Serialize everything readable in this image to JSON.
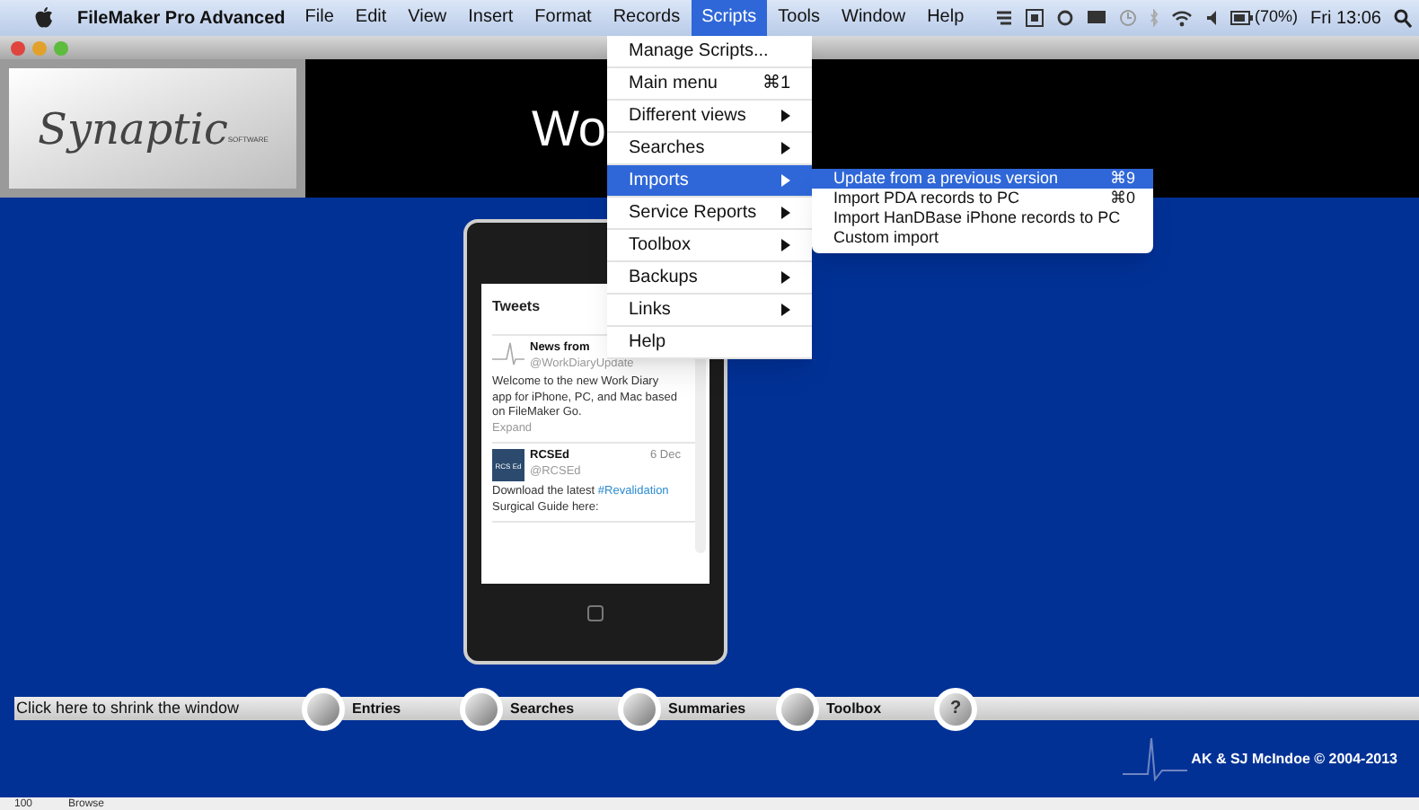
{
  "menu_bar": {
    "app_name": "FileMaker Pro Advanced",
    "items": [
      {
        "label": "File",
        "selected": false
      },
      {
        "label": "Edit",
        "selected": false
      },
      {
        "label": "View",
        "selected": false
      },
      {
        "label": "Insert",
        "selected": false
      },
      {
        "label": "Format",
        "selected": false
      },
      {
        "label": "Records",
        "selected": false
      },
      {
        "label": "Scripts",
        "selected": true
      },
      {
        "label": "Tools",
        "selected": false
      },
      {
        "label": "Window",
        "selected": false
      },
      {
        "label": "Help",
        "selected": false
      }
    ],
    "battery": "(70%)",
    "clock": "Fri 13:06"
  },
  "header": {
    "logo": "Synaptic",
    "logo_sub": "SOFTWARE",
    "title": "Wo"
  },
  "scripts_menu": [
    {
      "label": "Manage Scripts...",
      "selected": false
    },
    {
      "label": "Main menu",
      "shortcut": "⌘1",
      "selected": false
    },
    {
      "label": "Different views",
      "submenu": true,
      "selected": false
    },
    {
      "label": "Searches",
      "submenu": true,
      "selected": false
    },
    {
      "label": "Imports",
      "submenu": true,
      "selected": true
    },
    {
      "label": "Service Reports",
      "submenu": true,
      "selected": false
    },
    {
      "label": "Toolbox",
      "submenu": true,
      "selected": false
    },
    {
      "label": "Backups",
      "submenu": true,
      "selected": false
    },
    {
      "label": "Links",
      "submenu": true,
      "selected": false
    },
    {
      "label": "Help",
      "selected": false
    }
  ],
  "imports_submenu": [
    {
      "label": "Update from a previous version",
      "shortcut": "⌘9",
      "selected": true
    },
    {
      "label": "Import PDA records to PC",
      "shortcut": "⌘0",
      "selected": false
    },
    {
      "label": "Import HanDBase iPhone records to PC",
      "selected": false
    },
    {
      "label": "Custom import",
      "selected": false
    }
  ],
  "tweets": {
    "title": "Tweets",
    "items": [
      {
        "name": "News from",
        "handle": "@WorkDiaryUpdate",
        "body": [
          {
            "kind": "text",
            "text": "Welcome to the new Work Diary app for iPhone, PC, and Mac based on FileMaker Go."
          }
        ],
        "action": "Expand"
      },
      {
        "name": "RCSEd",
        "avatar": "RCS Ed",
        "date": "6 Dec",
        "handle": "@RCSEd",
        "body": [
          {
            "kind": "text",
            "text": "Download the latest "
          },
          {
            "kind": "hashtag",
            "text": "#Revalidation"
          },
          {
            "kind": "text",
            "text": " Surgical Guide here:"
          }
        ]
      }
    ]
  },
  "nav_bar": {
    "shrink": "Click here to shrink the window",
    "buttons": [
      {
        "label": "Entries",
        "kind": "round"
      },
      {
        "label": "Searches",
        "kind": "round"
      },
      {
        "label": "Summaries",
        "kind": "round"
      },
      {
        "label": "Toolbox",
        "kind": "round"
      },
      {
        "label": "?",
        "kind": "help"
      }
    ]
  },
  "copyright": "AK & SJ McIndoe © 2004-2013",
  "status_bar": {
    "zoom": "100",
    "mode": "Browse"
  }
}
